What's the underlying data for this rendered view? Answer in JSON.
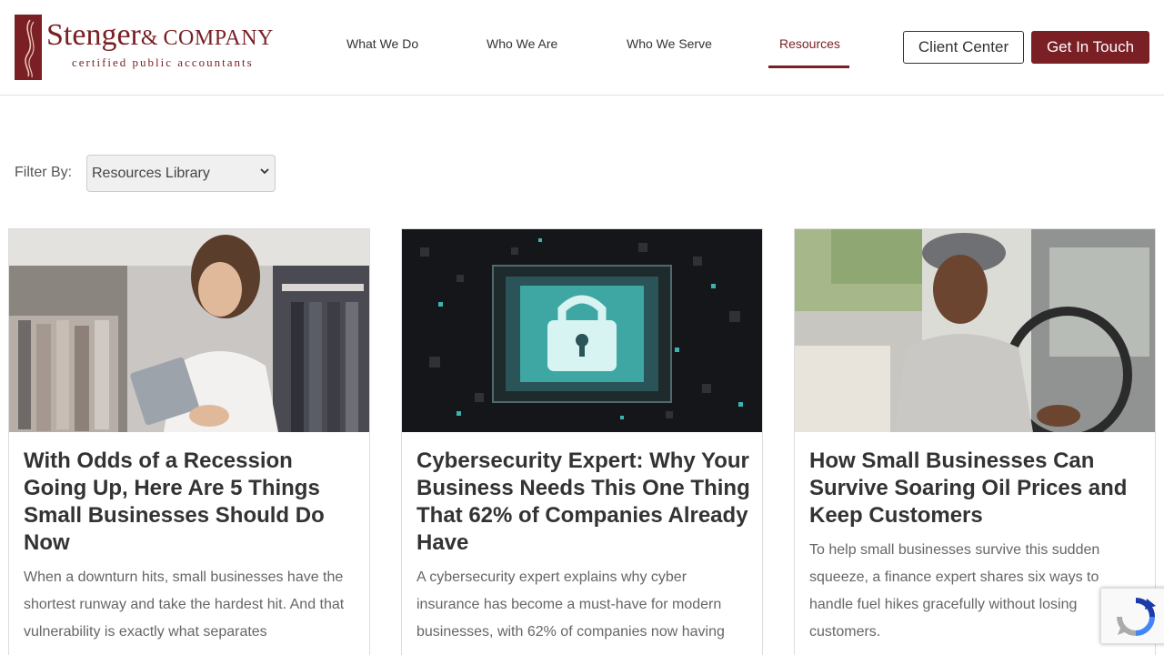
{
  "brand": {
    "name_main": "Stenger",
    "name_amp": "& ",
    "name_company": "COMPANY",
    "tagline": "certified public accountants",
    "color": "#7a1f24"
  },
  "nav": {
    "items": [
      {
        "label": "What We Do"
      },
      {
        "label": "Who We Are"
      },
      {
        "label": "Who We Serve"
      },
      {
        "label": "Resources",
        "active": true
      }
    ],
    "client_center": "Client Center",
    "get_in_touch": "Get In Touch"
  },
  "filter": {
    "label": "Filter By:",
    "selected": "Resources Library"
  },
  "cards": [
    {
      "title": "With Odds of a Recession Going Up, Here Are 5 Things Small Businesses Should Do Now",
      "description": "When a downturn hits, small businesses have the shortest runway and take the hardest hit. And that vulnerability is exactly what separates",
      "image": "woman-with-tablet-in-clothing-store"
    },
    {
      "title": "Cybersecurity Expert: Why Your Business Needs This One Thing That 62% of Companies Already Have",
      "description": "A cybersecurity expert explains why cyber insurance has become a must-have for modern businesses, with 62% of companies now having",
      "image": "padlock-on-circuit-board"
    },
    {
      "title": "How Small Businesses Can Survive Soaring Oil Prices and Keep Customers",
      "description": "To help small businesses survive this sudden squeeze, a finance expert shares six ways to handle fuel hikes gracefully without losing customers.",
      "image": "delivery-driver-in-van"
    }
  ],
  "icons": {
    "dropdown": "chevron-down-icon",
    "recaptcha": "recaptcha-icon"
  }
}
